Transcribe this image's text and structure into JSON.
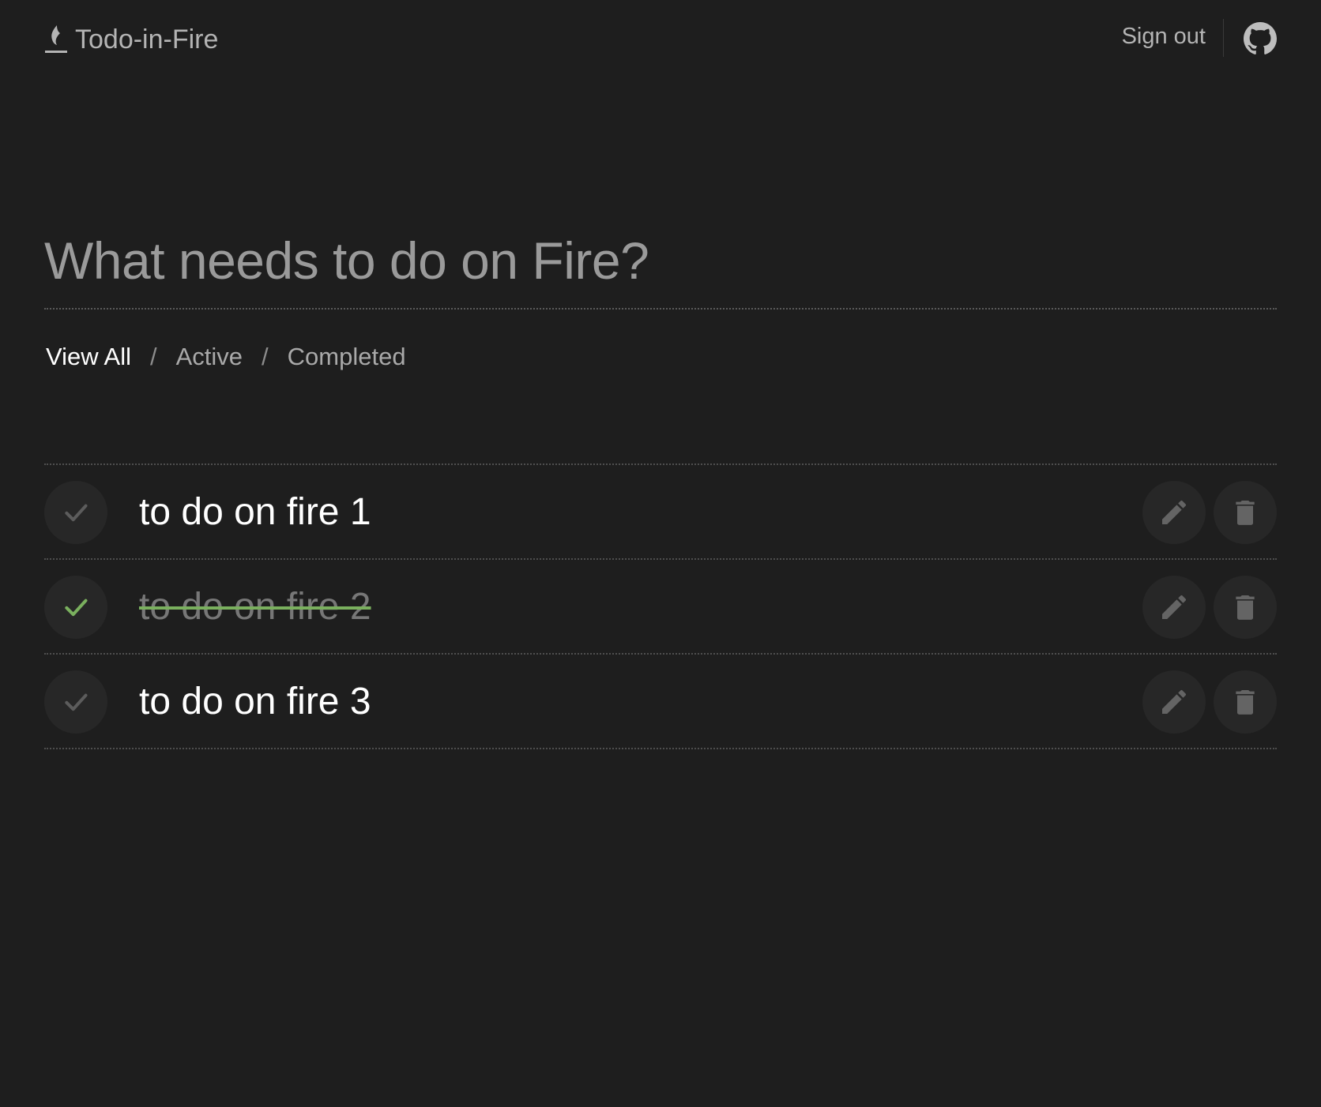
{
  "app": {
    "title": "Todo-in-Fire"
  },
  "header": {
    "signout_label": "Sign out"
  },
  "new_todo": {
    "placeholder": "What needs to do on Fire?",
    "value": ""
  },
  "filters": {
    "items": [
      {
        "label": "View All",
        "active": true
      },
      {
        "label": "Active",
        "active": false
      },
      {
        "label": "Completed",
        "active": false
      }
    ],
    "separator": "/"
  },
  "todos": [
    {
      "text": "to do on fire 1",
      "completed": false
    },
    {
      "text": "to do on fire 2",
      "completed": true
    },
    {
      "text": "to do on fire 3",
      "completed": false
    }
  ],
  "colors": {
    "background": "#1e1e1e",
    "accent_check": "#7ab05e",
    "inactive_check": "#5c5c5c",
    "icon": "#646464",
    "text_primary": "#ffffff",
    "text_muted": "#b4b4b4"
  },
  "icons": {
    "brand": "flame-icon",
    "github": "github-icon",
    "check": "check-icon",
    "edit": "pencil-icon",
    "delete": "trash-icon"
  }
}
